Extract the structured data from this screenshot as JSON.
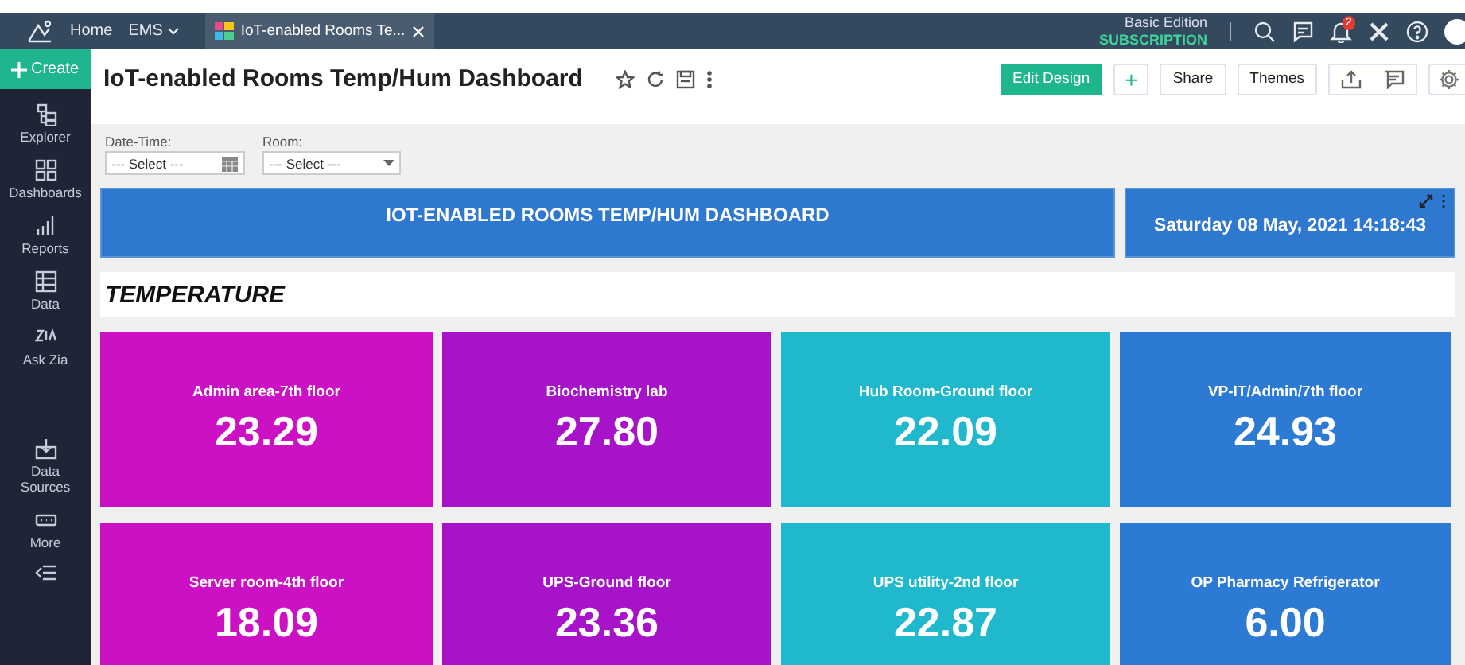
{
  "top_bar": {
    "nav": [
      {
        "label": "Home",
        "kind": "link"
      },
      {
        "label": "EMS",
        "kind": "menu"
      }
    ],
    "tab": {
      "label": "IoT-enabled Rooms Te...",
      "selected": true
    },
    "edition": "Basic Edition",
    "subscription": "SUBSCRIPTION",
    "notification_count": "2"
  },
  "sidebar": {
    "create": "Create",
    "items": [
      {
        "label": "Explorer",
        "kind": "explorer"
      },
      {
        "label": "Dashboards",
        "kind": "dashboards"
      },
      {
        "label": "Reports",
        "kind": "reports"
      },
      {
        "label": "Data",
        "kind": "data"
      },
      {
        "label": "Ask Zia",
        "kind": "zia"
      },
      {
        "label": "Data Sources",
        "kind": "sources"
      },
      {
        "label": "More",
        "kind": "more"
      }
    ]
  },
  "header": {
    "title": "IoT-enabled Rooms Temp/Hum Dashboard",
    "buttons": [
      {
        "label": "Edit Design",
        "kind": "primary"
      },
      {
        "label": "+",
        "kind": "plus"
      },
      {
        "label": "Share",
        "kind": "text"
      },
      {
        "label": "Themes",
        "kind": "text"
      }
    ]
  },
  "filters": [
    {
      "label": "Date-Time:",
      "placeholder": "--- Select ---",
      "kind": "date"
    },
    {
      "label": "Room:",
      "placeholder": "--- Select ---",
      "kind": "dropdown"
    }
  ],
  "banner": {
    "title": "IOT-ENABLED ROOMS TEMP/HUM DASHBOARD",
    "datetime": "Saturday 08 May, 2021 14:18:43"
  },
  "section": "TEMPERATURE",
  "tiles": [
    {
      "label": "Admin area-7th floor",
      "value": "23.29",
      "color": "#cc10c4"
    },
    {
      "label": "Biochemistry lab",
      "value": "27.80",
      "color": "#a713c8"
    },
    {
      "label": "Hub Room-Ground floor",
      "value": "22.09",
      "color": "#1fb8cc"
    },
    {
      "label": "VP-IT/Admin/7th floor",
      "value": "24.93",
      "color": "#2d7ad4"
    },
    {
      "label": "Server room-4th floor",
      "value": "18.09",
      "color": "#cc10c4"
    },
    {
      "label": "UPS-Ground floor",
      "value": "23.36",
      "color": "#a713c8"
    },
    {
      "label": "UPS utility-2nd floor",
      "value": "22.87",
      "color": "#1fb8cc"
    },
    {
      "label": "OP Pharmacy Refrigerator",
      "value": "6.00",
      "color": "#2d7ad4"
    }
  ]
}
